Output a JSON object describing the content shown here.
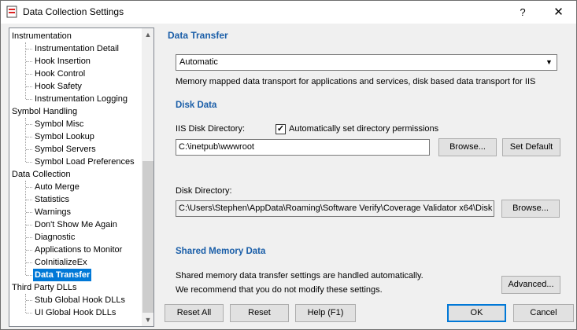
{
  "window": {
    "title": "Data Collection Settings",
    "help_label": "?",
    "close_label": "✕"
  },
  "tree": {
    "items": [
      {
        "label": "Instrumentation"
      },
      {
        "label": "Instrumentation Detail"
      },
      {
        "label": "Hook Insertion"
      },
      {
        "label": "Hook Control"
      },
      {
        "label": "Hook Safety"
      },
      {
        "label": "Instrumentation Logging"
      },
      {
        "label": "Symbol Handling"
      },
      {
        "label": "Symbol Misc"
      },
      {
        "label": "Symbol Lookup"
      },
      {
        "label": "Symbol Servers"
      },
      {
        "label": "Symbol Load Preferences"
      },
      {
        "label": "Data Collection"
      },
      {
        "label": "Auto Merge"
      },
      {
        "label": "Statistics"
      },
      {
        "label": "Warnings"
      },
      {
        "label": "Don't Show Me Again"
      },
      {
        "label": "Diagnostic"
      },
      {
        "label": "Applications to Monitor"
      },
      {
        "label": "CoInitializeEx"
      },
      {
        "label": "Data Transfer"
      },
      {
        "label": "Third Party DLLs"
      },
      {
        "label": "Stub Global Hook DLLs"
      },
      {
        "label": "UI Global Hook DLLs"
      }
    ],
    "selected": "Data Transfer"
  },
  "data_transfer": {
    "heading": "Data Transfer",
    "mode_selected": "Automatic",
    "description": "Memory mapped data transport for applications and services, disk based data transport for IIS"
  },
  "disk_data": {
    "heading": "Disk Data",
    "iis_label": "IIS Disk Directory:",
    "auto_perm_label": "Automatically set directory permissions",
    "auto_perm_checked": true,
    "iis_value": "C:\\inetpub\\wwwroot",
    "browse_label": "Browse...",
    "set_default_label": "Set Default",
    "disk_label": "Disk Directory:",
    "disk_value": "C:\\Users\\Stephen\\AppData\\Roaming\\Software Verify\\Coverage Validator x64\\Disk",
    "browse2_label": "Browse..."
  },
  "shared_memory": {
    "heading": "Shared Memory Data",
    "line1": "Shared memory data transfer settings are handled automatically.",
    "line2": "We recommend that you do not modify these settings.",
    "advanced_label": "Advanced..."
  },
  "footer": {
    "reset_all": "Reset All",
    "reset": "Reset",
    "help": "Help (F1)",
    "ok": "OK",
    "cancel": "Cancel"
  }
}
